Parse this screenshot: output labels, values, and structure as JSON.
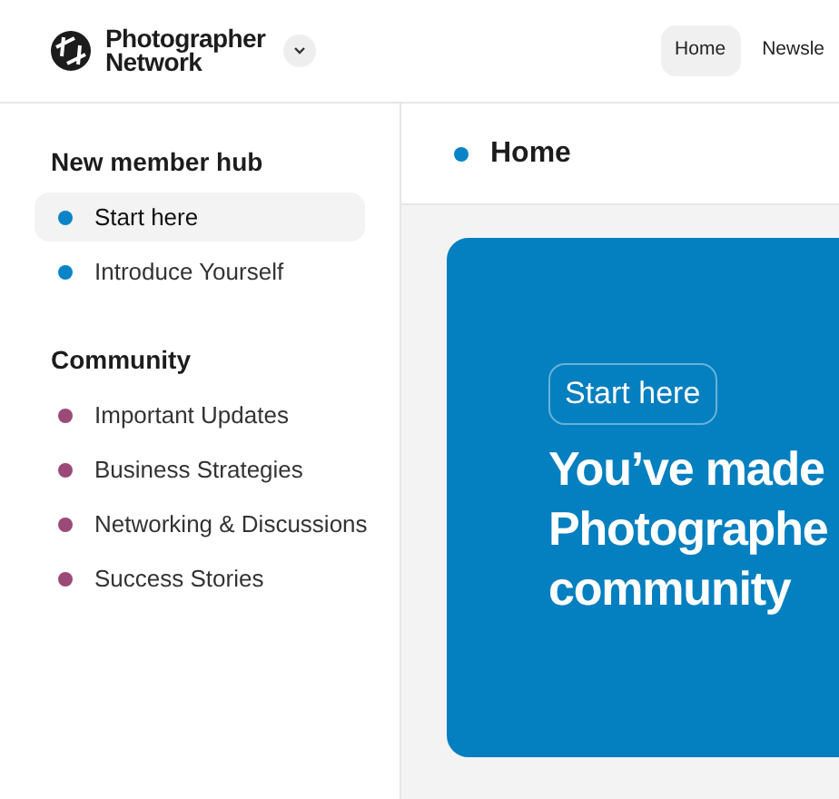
{
  "brand": {
    "name_lines": [
      "Photographer",
      "Network"
    ]
  },
  "top_nav": [
    {
      "label": "Home",
      "selected": true
    },
    {
      "label": "Newsle",
      "selected": false
    }
  ],
  "sidebar": [
    {
      "heading": "New member hub",
      "items": [
        {
          "label": "Start here",
          "color": "#0a84c6",
          "selected": true
        },
        {
          "label": "Introduce Yourself",
          "color": "#0a84c6",
          "selected": false
        }
      ]
    },
    {
      "heading": "Community",
      "items": [
        {
          "label": "Important Updates",
          "color": "#9b4a78",
          "selected": false
        },
        {
          "label": "Business Strategies",
          "color": "#9b4a78",
          "selected": false
        },
        {
          "label": "Networking & Discussions",
          "color": "#9b4a78",
          "selected": false
        },
        {
          "label": "Success Stories",
          "color": "#9b4a78",
          "selected": false
        }
      ]
    }
  ],
  "page": {
    "title": "Home",
    "color": "#0a84c6"
  },
  "banner": {
    "tag": "Start here",
    "headline_lines": [
      "You’ve made",
      "Photographe",
      "community"
    ]
  }
}
